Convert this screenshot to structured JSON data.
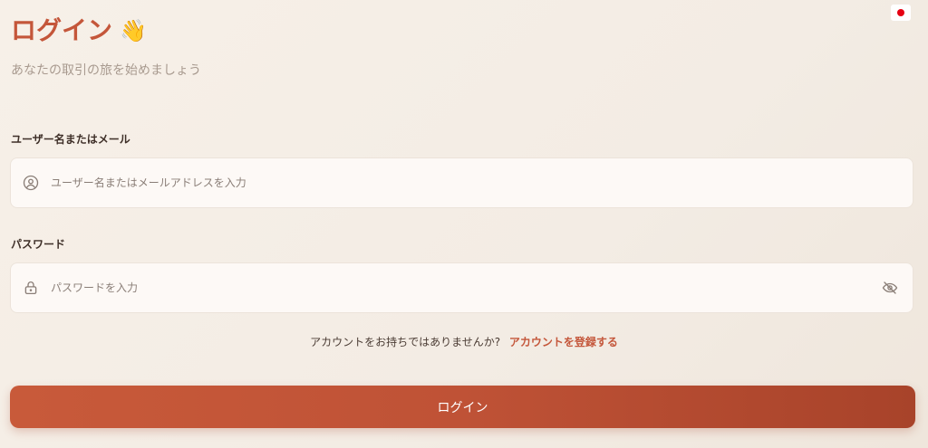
{
  "header": {
    "title": "ログイン",
    "wave_emoji": "👋",
    "subtitle": "あなたの取引の旅を始めましょう",
    "language_flag": "jp-flag-icon"
  },
  "form": {
    "username": {
      "label": "ユーザー名またはメール",
      "placeholder": "ユーザー名またはメールアドレスを入力",
      "value": "",
      "icon": "user-circle-icon"
    },
    "password": {
      "label": "パスワード",
      "placeholder": "パスワードを入力",
      "value": "",
      "icon": "lock-icon",
      "toggle_icon": "eye-off-icon"
    }
  },
  "signup": {
    "question": "アカウントをお持ちではありませんか?",
    "link": "アカウントを登録する"
  },
  "actions": {
    "login_label": "ログイン"
  },
  "colors": {
    "accent": "#c4563a",
    "button_start": "#c85a3a",
    "button_end": "#a8432a",
    "background": "#f5eee6"
  }
}
